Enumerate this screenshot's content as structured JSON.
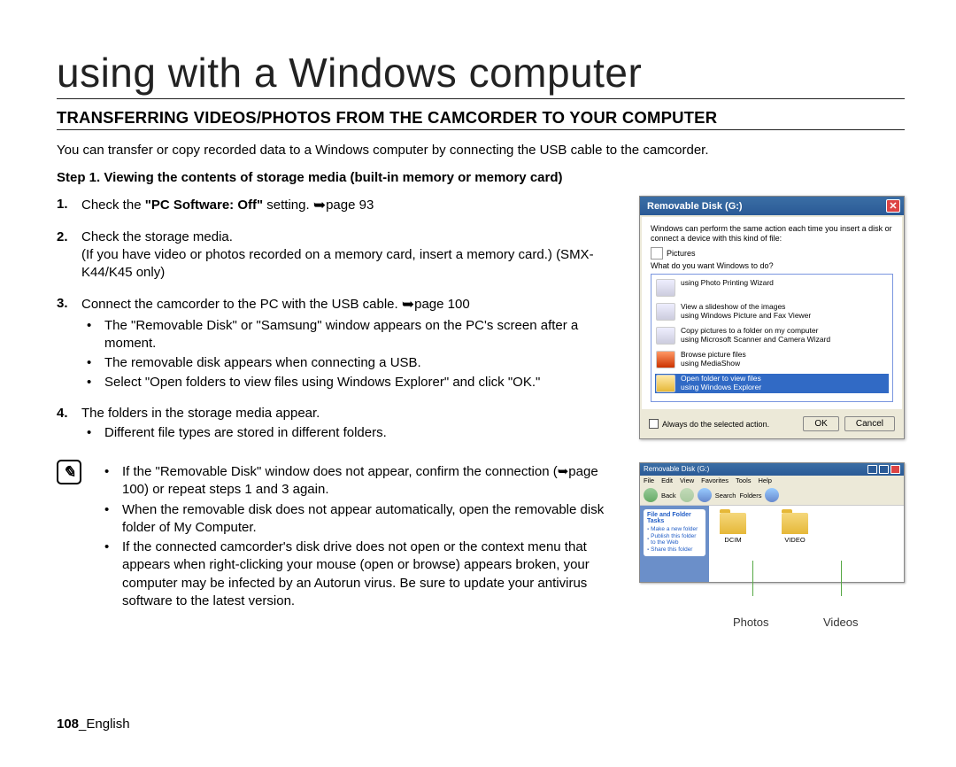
{
  "title": "using with a Windows computer",
  "heading": "TRANSFERRING VIDEOS/PHOTOS FROM THE CAMCORDER TO YOUR COMPUTER",
  "intro": "You can transfer or copy recorded data to a Windows computer by connecting the USB cable to the camcorder.",
  "step_title": "Step 1. Viewing the contents of storage media (built-in memory or memory card)",
  "steps": [
    {
      "num": "1.",
      "text_pre": "Check the ",
      "text_bold": "\"PC Software: Off\"",
      "text_post": " setting. ",
      "page_ref": "page 93"
    },
    {
      "num": "2.",
      "text": "Check the storage media.",
      "sub": "(If you have video or photos recorded on a memory card, insert a memory card.) (SMX-K44/K45 only)"
    },
    {
      "num": "3.",
      "text": "Connect the camcorder to the PC with the USB cable. ",
      "page_ref": "page 100",
      "bullets": [
        "The \"Removable Disk\" or \"Samsung\" window appears on the PC's screen after a moment.",
        "The removable disk appears when connecting a USB.",
        "Select \"Open folders to view files using Windows Explorer\" and click \"OK.\""
      ]
    },
    {
      "num": "4.",
      "text": "The folders in the storage media appear.",
      "bullets": [
        "Different file types are stored in different folders."
      ]
    }
  ],
  "notes": [
    "If the \"Removable Disk\" window does not appear, confirm the connection (➥page 100) or repeat steps 1 and 3 again.",
    "When the removable disk does not appear automatically, open the removable disk folder of My Computer.",
    "If the connected camcorder's disk drive does not open or the context menu that appears when right-clicking your mouse (open or browse) appears broken, your computer may be infected by an Autorun virus. Be sure to update your antivirus software to the latest version."
  ],
  "footer_page": "108",
  "footer_lang": "_English",
  "dialog": {
    "title": "Removable Disk (G:)",
    "msg1": "Windows can perform the same action each time you insert a disk or connect a device with this kind of file:",
    "pictures_label": "Pictures",
    "prompt": "What do you want Windows to do?",
    "options": [
      {
        "t1": "using Photo Printing Wizard",
        "t2": ""
      },
      {
        "t1": "View a slideshow of the images",
        "t2": "using Windows Picture and Fax Viewer"
      },
      {
        "t1": "Copy pictures to a folder on my computer",
        "t2": "using Microsoft Scanner and Camera Wizard"
      },
      {
        "t1": "Browse picture files",
        "t2": "using MediaShow"
      },
      {
        "t1": "Open folder to view files",
        "t2": "using Windows Explorer"
      }
    ],
    "always": "Always do the selected action.",
    "ok": "OK",
    "cancel": "Cancel"
  },
  "explorer": {
    "title": "Removable Disk (G:)",
    "menus": [
      "File",
      "Edit",
      "View",
      "Favorites",
      "Tools",
      "Help"
    ],
    "tool_back": "Back",
    "tool_search": "Search",
    "tool_folders": "Folders",
    "side_title": "File and Folder Tasks",
    "side_items": [
      "Make a new folder",
      "Publish this folder to the Web",
      "Share this folder"
    ],
    "folders": [
      "DCIM",
      "VIDEO"
    ]
  },
  "callouts": {
    "photos": "Photos",
    "videos": "Videos"
  }
}
